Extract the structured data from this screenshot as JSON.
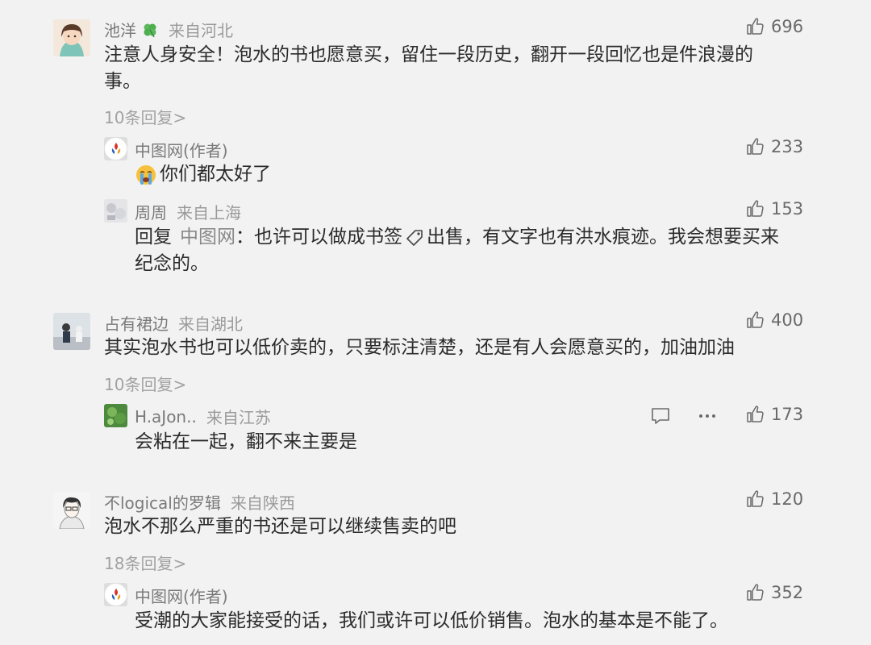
{
  "comments": [
    {
      "user": "池洋",
      "location": "来自河北",
      "text_line1": "注意人身安全！泡水的书也愿意买，留住一段历史，翻开一段回忆也是件浪漫的",
      "text_line2": "事。",
      "likes": "696",
      "replies_label": "10条回复>",
      "sub": [
        {
          "user": "中图网(作者)",
          "text": "你们都太好了",
          "likes": "233",
          "emoji": "crying-face"
        },
        {
          "user": "周周",
          "location": "来自上海",
          "reply_prefix": "回复",
          "mention": "中图网",
          "text_a": "：也许可以做成书签",
          "text_b": "出售，有文字也有洪水痕迹。我会想要买来",
          "text_line2": "纪念的。",
          "likes": "153"
        }
      ]
    },
    {
      "user": "占有裙边",
      "location": "来自湖北",
      "text_line1": "其实泡水书也可以低价卖的，只要标注清楚，还是有人会愿意买的，加油加油",
      "likes": "400",
      "replies_label": "10条回复>",
      "sub": [
        {
          "user": "H.aJon..",
          "location": "来自江苏",
          "text": "会粘在一起，翻不来主要是",
          "likes": "173"
        }
      ]
    },
    {
      "user": "不logical的罗辑",
      "location": "来自陕西",
      "text_line1": "泡水不那么严重的书还是可以继续售卖的吧",
      "likes": "120",
      "replies_label": "18条回复>",
      "sub": [
        {
          "user": "中图网(作者)",
          "text": "受潮的大家能接受的话，我们或许可以低价销售。泡水的基本是不能了。",
          "likes": "352"
        }
      ]
    }
  ],
  "icons": {
    "like": "thumbs-up-icon",
    "comment": "comment-icon",
    "more": "more-icon",
    "clover": "clover-icon",
    "tag": "bookmark-tag-icon"
  },
  "colors": {
    "background": "#f2f2f2",
    "text": "#2b2b2b",
    "meta": "#9a9a9a",
    "accent": "#6a6a6a"
  }
}
